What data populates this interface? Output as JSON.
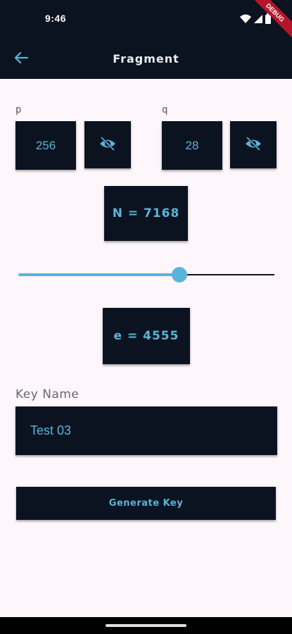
{
  "status_bar": {
    "time": "9:46",
    "icons": [
      "wifi-icon",
      "signal-icon",
      "battery-icon"
    ]
  },
  "app_bar": {
    "title": "Fragment",
    "back_icon": "arrow-left-icon"
  },
  "debug_banner": "DEBUG",
  "p": {
    "label": "p",
    "value": "256",
    "visibility_icon": "eye-off-icon"
  },
  "q": {
    "label": "q",
    "value": "28",
    "visibility_icon": "eye-off-icon"
  },
  "n_result": "N = 7168",
  "slider": {
    "fraction": 0.63
  },
  "e_result": "e = 4555",
  "key_name": {
    "label": "Key Name",
    "value": "Test 03"
  },
  "generate_button": "Generate Key",
  "colors": {
    "dark": "#0b1320",
    "accent": "#5bb4d8",
    "background": "#fdf6fb"
  }
}
